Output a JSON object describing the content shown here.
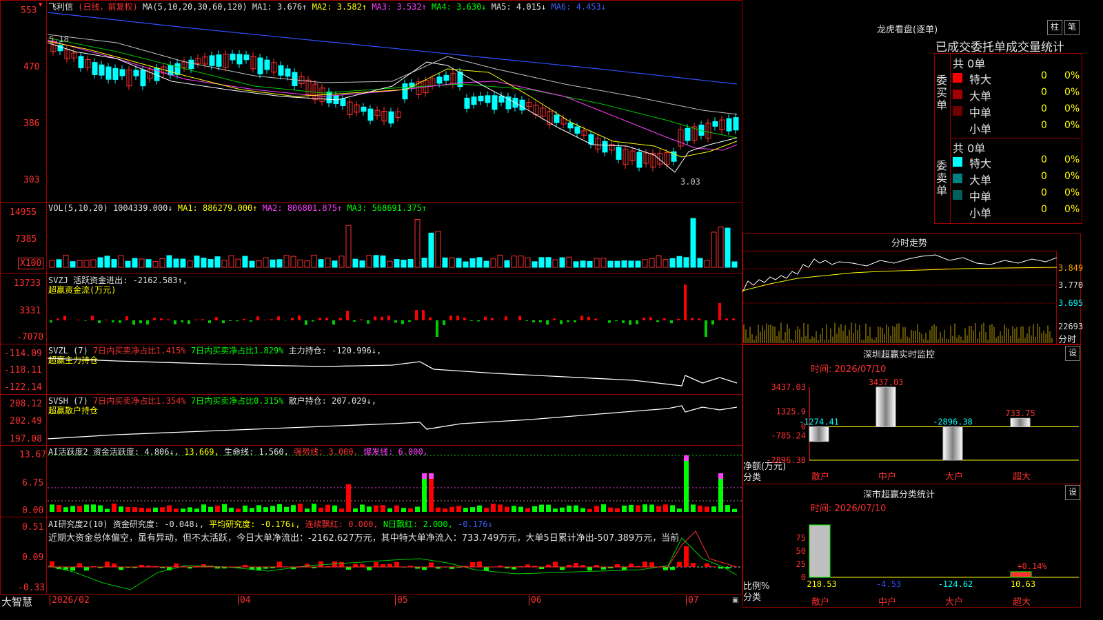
{
  "main": {
    "header": {
      "name": "飞利信",
      "mode": "(日线，前复权)",
      "ma_label": "MA(5,10,20,30,60,120)",
      "ma1": "MA1: 3.676↑",
      "ma2": "MA2: 3.582↑",
      "ma3": "MA3: 3.532↑",
      "ma4": "MA4: 3.630↓",
      "ma5": "MA5: 4.015↓",
      "ma6": "MA6: 4.453↓"
    },
    "y_labels": [
      "553",
      "470",
      "386",
      "303"
    ],
    "hi_note": "5.18",
    "lo_note": "3.03"
  },
  "vol": {
    "header": "VOL(5,10,20)",
    "v": "1004339.000↓",
    "ma1": "MA1: 886279.000↑",
    "ma2": "MA2: 806801.875↑",
    "ma3": "MA3: 568691.375↑",
    "y_labels": [
      "14955",
      "7385",
      "X100"
    ]
  },
  "svzj": {
    "header": "SVZJ  活跃资金进出: -2162.583↑,",
    "sub": "超赢资金流(万元)",
    "y_labels": [
      "13733",
      "3331",
      "-7070"
    ]
  },
  "svzl": {
    "name": "SVZL (7)",
    "p1": "7日内买卖净占比1.415%",
    "p2": "7日内买卖净占比1.829%",
    "p3": "主力持仓: -120.996↓,",
    "sub": "超赢主力持仓",
    "y_labels": [
      "-114.09",
      "-118.11",
      "-122.14"
    ]
  },
  "svsh": {
    "name": "SVSH (7)",
    "p1": "7日内买卖净占比1.354%",
    "p2": "7日内买卖净占比0.315%",
    "p3": "散户持仓: 207.029↓,",
    "sub": "超赢散户持仓",
    "y_labels": [
      "208.12",
      "202.49",
      "197.08"
    ]
  },
  "ai1": {
    "name": "AI活跃度2",
    "p1": "资金活跃度: 4.806↓,",
    "p2": "13.669,",
    "p3": "生命线: 1.560,",
    "p4": "强势线: 3.000,",
    "p5": "爆发线: 6.000,",
    "y_labels": [
      "13.67",
      "6.75",
      "0.00"
    ]
  },
  "ai2": {
    "name": "AI研究度2(10)",
    "p1": "资金研究度: -0.048↓,",
    "p2": "平均研究度: -0.176↓,",
    "p3": "连续飘红: 0.000,",
    "p4": "N日飘红: 2.000,",
    "p5": "-0.176↓",
    "text": "近期大资金总体偏空，虽有异动，但不太活跃，今日大单净流出：-2162.627万元，其中特大单净流入：733.749万元，大单5日累计净出-507.389万元，当前",
    "y_labels": [
      "0.51",
      "0.09",
      "-0.33"
    ]
  },
  "footer": {
    "brand": "大智慧",
    "dates": [
      "2026/02",
      "04",
      "05",
      "06",
      "07"
    ]
  },
  "right": {
    "lhb_title": "龙虎看盘(逐单)",
    "tab1": "柱",
    "tab2": "笔",
    "stat_title": "已成交委托单成交量统计",
    "buy_label": "委买单",
    "sell_label": "委卖单",
    "buy_total": "共 0单",
    "sell_total": "共 0单",
    "buy_rows": [
      {
        "label": "特大",
        "val": "0",
        "pct": "0%",
        "color": "#ff0000"
      },
      {
        "label": "大单",
        "val": "0",
        "pct": "0%",
        "color": "#a00000"
      },
      {
        "label": "中单",
        "val": "0",
        "pct": "0%",
        "color": "#700000"
      },
      {
        "label": "小单",
        "val": "0",
        "pct": "0%",
        "color": ""
      }
    ],
    "sell_rows": [
      {
        "label": "特大",
        "val": "0",
        "pct": "0%",
        "color": "#00ffff"
      },
      {
        "label": "大单",
        "val": "0",
        "pct": "0%",
        "color": "#008080"
      },
      {
        "label": "中单",
        "val": "0",
        "pct": "0%",
        "color": "#006060"
      },
      {
        "label": "小单",
        "val": "0",
        "pct": "0%",
        "color": ""
      }
    ],
    "fenshi_title": "分时走势",
    "fenshi_labels": [
      "3.849",
      "3.770",
      "3.695",
      "22693",
      "分时"
    ],
    "sz_title": "深圳超赢实时监控",
    "sz_set": "设",
    "sz_time": "时间: 2026/07/10",
    "sz_y": [
      "3437.03",
      "1325.9",
      "0",
      "-785.24",
      "-2896.38"
    ],
    "sz_axis": "净额(万元)",
    "sz_axis2": "分类",
    "sz_cats": [
      "散户",
      "中户",
      "大户",
      "超大"
    ],
    "sz_vals": [
      "-1274.41",
      "3437.03",
      "-2896.38",
      "733.75"
    ],
    "fl_title": "深市超赢分类统计",
    "fl_set": "设",
    "fl_time": "时间: 2026/07/10",
    "fl_y": [
      "75",
      "50",
      "25",
      "0"
    ],
    "fl_axis": "比例%",
    "fl_axis2": "分类",
    "fl_vals": [
      "218.53",
      "-4.53",
      "-124.62",
      "10.63"
    ],
    "fl_note": "+0.14%",
    "fl_cats": [
      "散户",
      "中户",
      "大户",
      "超大"
    ]
  },
  "chart_data": [
    {
      "type": "bar",
      "title": "深圳超赢实时监控",
      "categories": [
        "散户",
        "中户",
        "大户",
        "超大"
      ],
      "values": [
        -1274.41,
        3437.03,
        -2896.38,
        733.75
      ],
      "ylabel": "净额(万元)",
      "ylim": [
        -2896.38,
        3437.03
      ]
    },
    {
      "type": "bar",
      "title": "深市超赢分类统计",
      "categories": [
        "散户",
        "中户",
        "大户",
        "超大"
      ],
      "values": [
        218.53,
        -4.53,
        -124.62,
        10.63
      ],
      "ylabel": "比例%"
    }
  ]
}
